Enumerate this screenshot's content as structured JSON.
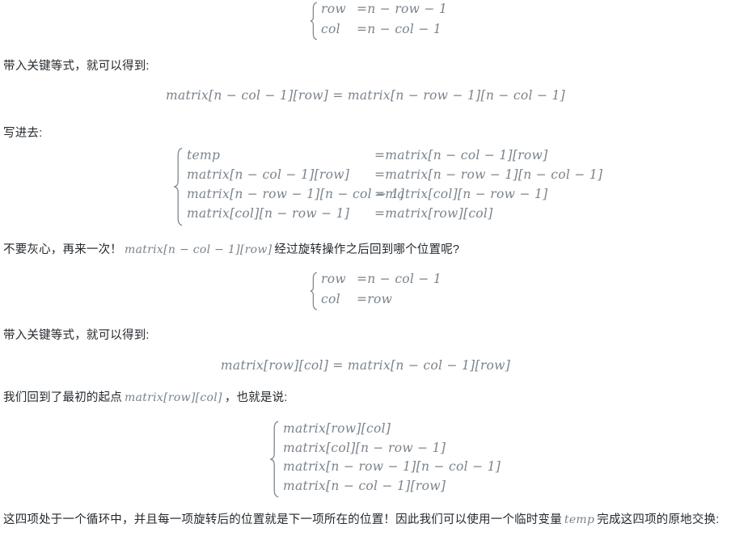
{
  "document": {
    "language": "zh-CN",
    "topic": "矩阵原地旋转推导",
    "text_color": "#24292e",
    "math_color": "#7a838c",
    "background": "#ffffff"
  },
  "blocks": [
    {
      "id": "system-1",
      "kind": "display-system",
      "brace": "{",
      "rows": [
        {
          "lhs": "row",
          "op": "=",
          "rhs": "n − row − 1"
        },
        {
          "lhs": "col",
          "op": "=",
          "rhs": "n − col − 1"
        }
      ]
    },
    {
      "id": "para-1",
      "kind": "paragraph",
      "text": "带入关键等式，就可以得到:"
    },
    {
      "id": "equation-1",
      "kind": "display-equation",
      "text": "matrix[n − col − 1][row] = matrix[n − row − 1][n − col − 1]"
    },
    {
      "id": "para-2",
      "kind": "paragraph",
      "text": "写进去:"
    },
    {
      "id": "system-2",
      "kind": "display-system",
      "brace": "{",
      "rows": [
        {
          "lhs": "temp",
          "op": "=",
          "rhs": "matrix[n − col − 1][row]"
        },
        {
          "lhs": "matrix[n − col − 1][row]",
          "op": "=",
          "rhs": "matrix[n − row − 1][n − col − 1]"
        },
        {
          "lhs": "matrix[n − row − 1][n − col − 1]",
          "op": "=",
          "rhs": "matrix[col][n − row − 1]"
        },
        {
          "lhs": "matrix[col][n − row − 1]",
          "op": "=",
          "rhs": "matrix[row][col]"
        }
      ]
    },
    {
      "id": "para-3",
      "kind": "paragraph-inline-math",
      "text_before": "不要灰心，再来一次！",
      "inline_math": "matrix[n − col − 1][row]",
      "text_after": "经过旋转操作之后回到哪个位置呢?"
    },
    {
      "id": "system-3",
      "kind": "display-system",
      "brace": "{",
      "rows": [
        {
          "lhs": "row",
          "op": "=",
          "rhs": "n − col − 1"
        },
        {
          "lhs": "col",
          "op": "=",
          "rhs": "row"
        }
      ]
    },
    {
      "id": "para-4",
      "kind": "paragraph",
      "text": "带入关键等式，就可以得到:"
    },
    {
      "id": "equation-2",
      "kind": "display-equation",
      "text": "matrix[row][col] = matrix[n − col − 1][row]"
    },
    {
      "id": "para-5",
      "kind": "paragraph-inline-math",
      "text_before": "我们回到了最初的起点",
      "inline_math": "matrix[row][col]",
      "text_after": "，也就是说:"
    },
    {
      "id": "system-4",
      "kind": "display-list",
      "brace": "{",
      "rows": [
        {
          "lhs": "matrix[row][col]"
        },
        {
          "lhs": "matrix[col][n − row − 1]"
        },
        {
          "lhs": "matrix[n − row − 1][n − col − 1]"
        },
        {
          "lhs": "matrix[n − col − 1][row]"
        }
      ]
    },
    {
      "id": "para-6",
      "kind": "paragraph-inline-math-wrap",
      "text_before": "这四项处于一个循环中，并且每一项旋转后的位置就是下一项所在的位置！因此我们可以使用一个临时变量",
      "inline_math": "temp",
      "text_after": "完成这四项的原地交换:"
    }
  ]
}
